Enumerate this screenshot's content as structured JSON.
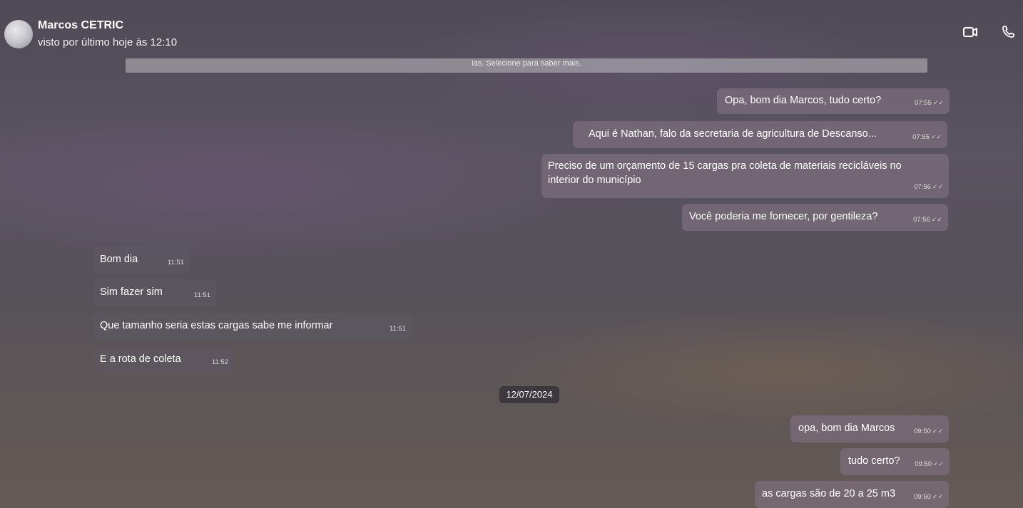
{
  "header": {
    "contact_name": "Marcos CETRIC",
    "status": "visto por último hoje às 12:10",
    "video_icon": "video-camera-icon",
    "call_icon": "phone-icon"
  },
  "banner": {
    "text": "ias. Selecione para saber mais."
  },
  "messages_day1_out": [
    {
      "text": "Opa, bom dia Marcos, tudo certo?",
      "time": "07:55"
    },
    {
      "text": "Aqui é Nathan, falo da secretaria de agricultura de Descanso...",
      "time": "07:55"
    },
    {
      "text": "Preciso de um orçamento de 15 cargas pra coleta de materiais recicláveis no interior do município",
      "time": "07:56"
    },
    {
      "text": "Você poderia me fornecer, por gentileza?",
      "time": "07:56"
    }
  ],
  "messages_day1_in": [
    {
      "text": "Bom dia",
      "time": "11:51"
    },
    {
      "text": "Sim fazer sim",
      "time": "11:51"
    },
    {
      "text": "Que tamanho seria estas cargas sabe me informar",
      "time": "11:51"
    },
    {
      "text": "E a rota de coleta",
      "time": "11:52"
    }
  ],
  "date_separator": "12/07/2024",
  "messages_day2_out": [
    {
      "text": "opa, bom dia Marcos",
      "time": "09:50"
    },
    {
      "text": "tudo certo?",
      "time": "09:50"
    },
    {
      "text": "as cargas são de 20 a 25 m3",
      "time": "09:50"
    }
  ],
  "tick_glyph": "✓✓"
}
